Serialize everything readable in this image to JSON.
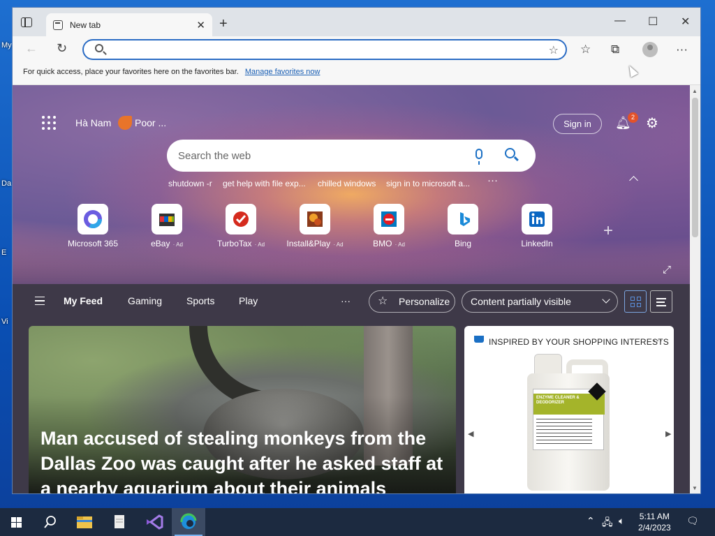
{
  "desktop": {
    "icon_labels": [
      "My",
      "Da",
      "E",
      "Vi"
    ]
  },
  "browser": {
    "tab": {
      "title": "New tab"
    },
    "window_controls": {
      "minimize": "—",
      "maximize": "☐",
      "close": "✕"
    },
    "address_bar": {
      "value": "",
      "placeholder": ""
    },
    "favorites_bar": {
      "message": "For quick access, place your favorites here on the favorites bar.",
      "link": "Manage favorites now"
    }
  },
  "newtab": {
    "location": "Hà Nam",
    "weather": "Poor ...",
    "sign_in": "Sign in",
    "notification_count": "2",
    "search": {
      "placeholder": "Search the web"
    },
    "trending": [
      "shutdown -r",
      "get help with file exp...",
      "chilled windows",
      "sign in to microsoft a..."
    ],
    "trending_more": "···",
    "quick_links": [
      {
        "label": "Microsoft 365",
        "ad": "",
        "icon": "microsoft365-icon"
      },
      {
        "label": "eBay",
        "ad": "Ad",
        "icon": "ebay-icon"
      },
      {
        "label": "TurboTax",
        "ad": "Ad",
        "icon": "turbotax-icon"
      },
      {
        "label": "Install&Play",
        "ad": "Ad",
        "icon": "install-play-icon"
      },
      {
        "label": "BMO",
        "ad": "Ad",
        "icon": "bmo-icon"
      },
      {
        "label": "Bing",
        "ad": "",
        "icon": "bing-icon"
      },
      {
        "label": "LinkedIn",
        "ad": "",
        "icon": "linkedin-icon"
      }
    ],
    "add_tile": "+",
    "feed_nav": {
      "items": [
        "My Feed",
        "Gaming",
        "Sports",
        "Play"
      ],
      "more": "···",
      "personalize": "Personalize",
      "content_visibility": "Content partially visible"
    },
    "story": {
      "headline": "Man accused of stealing monkeys from the Dallas Zoo was caught after he asked staff at a nearby aquarium about their animals"
    },
    "shopping": {
      "header": "INSPIRED BY YOUR SHOPPING INTERESTS",
      "more": "···",
      "product_label": "ENZYME CLEANER & DEODORIZER"
    }
  },
  "taskbar": {
    "time": "5:11 AM",
    "date": "2/4/2023"
  },
  "colors": {
    "accent": "#1a6fc4",
    "taskbar": "#1c2a40",
    "feed_background": "#3e3948",
    "notification_badge": "#e3522a"
  }
}
